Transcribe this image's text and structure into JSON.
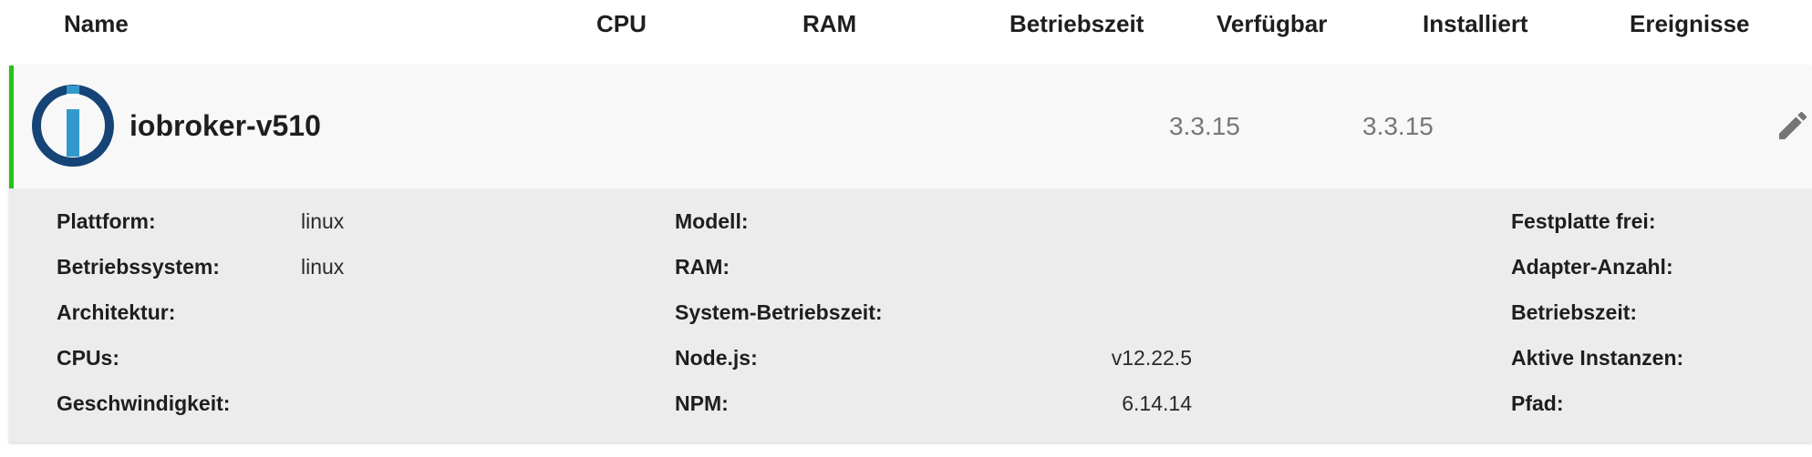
{
  "columns": {
    "name": "Name",
    "cpu": "CPU",
    "ram": "RAM",
    "uptime": "Betriebszeit",
    "available": "Verfügbar",
    "installed": "Installiert",
    "events": "Ereignisse"
  },
  "host": {
    "name": "iobroker-v510",
    "available": "3.3.15",
    "installed": "3.3.15",
    "status_color": "#26c214",
    "logo_color": "#164477",
    "logo_accent": "#3399cc"
  },
  "details": {
    "platform_label": "Plattform:",
    "platform_value": "linux",
    "os_label": "Betriebssystem:",
    "os_value": "linux",
    "arch_label": "Architektur:",
    "cpus_label": "CPUs:",
    "speed_label": "Geschwindigkeit:",
    "model_label": "Modell:",
    "ram_label": "RAM:",
    "sys_uptime_label": "System-Betriebszeit:",
    "node_label": "Node.js:",
    "node_value": "v12.22.5",
    "npm_label": "NPM:",
    "npm_value": "6.14.14",
    "disk_free_label": "Festplatte frei:",
    "adapter_count_label": "Adapter-Anzahl:",
    "uptime_label": "Betriebszeit:",
    "active_instances_label": "Aktive Instanzen:",
    "path_label": "Pfad:"
  }
}
